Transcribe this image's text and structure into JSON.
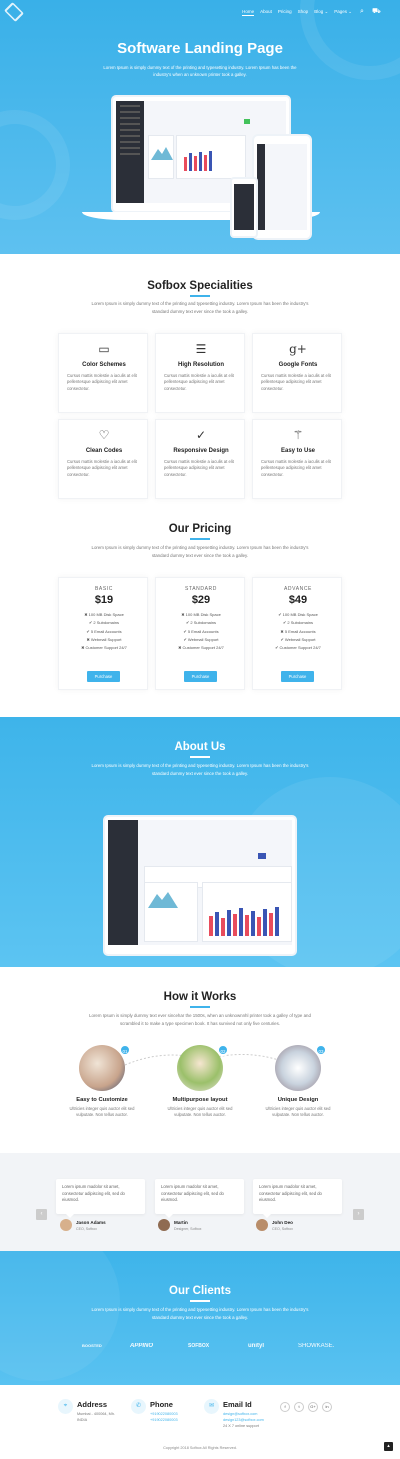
{
  "nav": {
    "items": [
      "Home",
      "About",
      "Pricing",
      "Shop",
      "Blog ⌄",
      "Pages ⌄"
    ],
    "active_index": 0
  },
  "hero": {
    "title": "Software Landing Page",
    "subtitle": "Lorem Ipsum is simply dummy text of the printing and typesetting industry. Lorem Ipsum has been the industry's when an unknown printer took a galley."
  },
  "specialities": {
    "title": "Sofbox Specialities",
    "subtitle": "Lorem Ipsum is simply dummy text of the printing and typesetting industry. Lorem Ipsum has been the industry's standard dummy text ever since the took a galley.",
    "items": [
      {
        "icon": "monitor-icon",
        "glyph": "▭",
        "title": "Color Schemes",
        "desc": "Cursus mattis molestie a iaculis at elit pellentesque adipiscing elit amet consectetur."
      },
      {
        "icon": "sliders-icon",
        "glyph": "☰",
        "title": "High Resolution",
        "desc": "Cursus mattis molestie a iaculis at elit pellentesque adipiscing elit amet consectetur."
      },
      {
        "icon": "google-plus-icon",
        "glyph": "g+",
        "title": "Google Fonts",
        "desc": "Cursus mattis molestie a iaculis at elit pellentesque adipiscing elit amet consectetur."
      },
      {
        "icon": "heart-icon",
        "glyph": "♡",
        "title": "Clean Codes",
        "desc": "Cursus mattis molestie a iaculis at elit pellentesque adipiscing elit amet consectetur."
      },
      {
        "icon": "check-circle-icon",
        "glyph": "✓",
        "title": "Responsive Design",
        "desc": "Cursus mattis molestie a iaculis at elit pellentesque adipiscing elit amet consectetur."
      },
      {
        "icon": "magic-wand-icon",
        "glyph": "⚚",
        "title": "Easy to Use",
        "desc": "Cursus mattis molestie a iaculis at elit pellentesque adipiscing elit amet consectetur."
      }
    ]
  },
  "pricing": {
    "title": "Our Pricing",
    "subtitle": "Lorem Ipsum is simply dummy text of the printing and typesetting industry. Lorem Ipsum has been the industry's standard dummy text ever since the took a galley.",
    "plans": [
      {
        "name": "BASIC",
        "price": "$19",
        "features": [
          "✖ 100 MB Disk Space",
          "✔ 2 Subdomains",
          "✔ 5 Email Accounts",
          "✖ Webmail Support",
          "✖ Customer Support 24/7"
        ],
        "button": "Purchase"
      },
      {
        "name": "STANDARD",
        "price": "$29",
        "features": [
          "✖ 100 MB Disk Space",
          "✔ 2 Subdomains",
          "✔ 5 Email Accounts",
          "✔ Webmail Support",
          "✖ Customer Support 24/7"
        ],
        "button": "Purchase"
      },
      {
        "name": "ADVANCE",
        "price": "$49",
        "features": [
          "✔ 100 MB Disk Space",
          "✔ 2 Subdomains",
          "✖ 5 Email Accounts",
          "✔ Webmail Support",
          "✔ Customer Support 24/7"
        ],
        "button": "Purchase"
      }
    ]
  },
  "about": {
    "title": "About Us",
    "subtitle": "Lorem Ipsum is simply dummy text of the printing and typesetting industry. Lorem Ipsum has been the industry's standard dummy text ever since the took a galley."
  },
  "how": {
    "title": "How it Works",
    "subtitle": "Lorem Ipsum is simply dummy text ever sincehar the 1500s, when an unknownnhl printer took a galley of type and scrambled it to make a type specimen book. It has survived not only five centuries.",
    "steps": [
      {
        "num": "01",
        "title": "Easy to Customize",
        "desc": "Ultricies integer quis auctor elit sed vulputate. Non tellus auctor."
      },
      {
        "num": "02",
        "title": "Multipurpose layout",
        "desc": "Ultricies integer quis auctor elit sed vulputate. Non tellus auctor."
      },
      {
        "num": "03",
        "title": "Unique Design",
        "desc": "Ultricies integer quis auctor elit sed vulputate. Non tellus auctor."
      }
    ]
  },
  "testimonials": {
    "prev": "‹",
    "next": "›",
    "items": [
      {
        "text": "Lorem ipsum madolor sit amet, consectetur adipiscing elit, sed do eiusmod.",
        "name": "Jason Adams",
        "role": "CEO, Sofbox"
      },
      {
        "text": "Lorem ipsum madolor sit amet, consectetur adipiscing elit, sed do eiusmod.",
        "name": "Martin",
        "role": "Designer, Sofbox"
      },
      {
        "text": "Lorem ipsum madolor sit amet, consectetur adipiscing elit, sed do eiusmod.",
        "name": "John Deo",
        "role": "CEO, Sofbox"
      }
    ]
  },
  "clients": {
    "title": "Our Clients",
    "subtitle": "Lorem Ipsum is simply dummy text of the printing and typesetting industry. Lorem Ipsum has been the industry's standard dummy text ever since the took a galley.",
    "logos": [
      "BOOSTED",
      "APPINO",
      "SOFBOX",
      "unityl",
      "SHOWKASE."
    ]
  },
  "footer": {
    "address_title": "Address",
    "address_lines": [
      "Mumbai - 400064, Mh.",
      "INDIA"
    ],
    "phone_title": "Phone",
    "phone_lines": [
      "+919022080003",
      "+919022080003"
    ],
    "email_title": "Email Id",
    "email_lines": [
      "design@sofbox.com",
      "design123@sofbox.com",
      "24 X 7 online support"
    ],
    "social": [
      "f",
      "t",
      "G+",
      "in"
    ],
    "copyright": "Copyright 2018 Sofbox All Rights Reserved."
  },
  "colors": {
    "accent": "#3fb3eb",
    "hero_top": "#39b0e8",
    "hero_bottom": "#5ec1f0"
  }
}
